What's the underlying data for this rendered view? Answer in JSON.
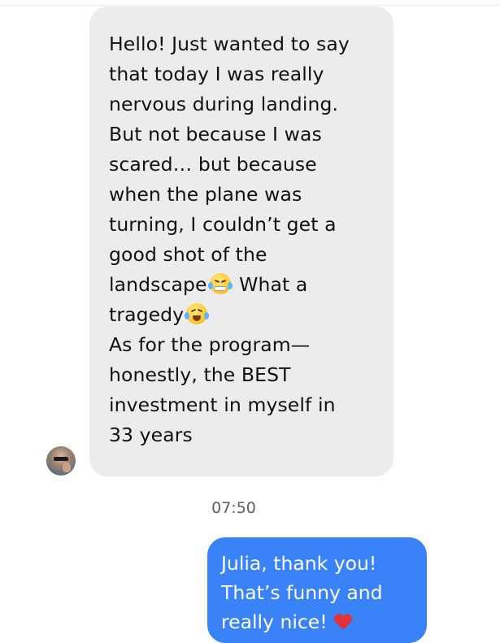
{
  "conversation": {
    "incoming": {
      "lines": [
        "Hello! Just wanted to say",
        "that today I was really",
        "nervous during landing.",
        "But not because I was",
        "scared… but because",
        "when the plane was",
        "turning, I couldn’t get a",
        "good shot of the",
        "landscape",
        "What a",
        "tragedy",
        "As for the program—",
        "honestly, the BEST",
        "investment in myself in",
        "33 years"
      ],
      "emojis": [
        "angry-tearful-face-icon",
        "tears-of-joy-icon"
      ]
    },
    "timestamp": "07:50",
    "outgoing": {
      "lines": [
        "Julia, thank you!",
        "That’s funny and",
        "really nice!"
      ],
      "emoji": "red-heart-icon"
    }
  },
  "colors": {
    "incoming_bubble": "#ececec",
    "outgoing_bubble": "#3a82f7",
    "timestamp": "#5e5e5e"
  }
}
